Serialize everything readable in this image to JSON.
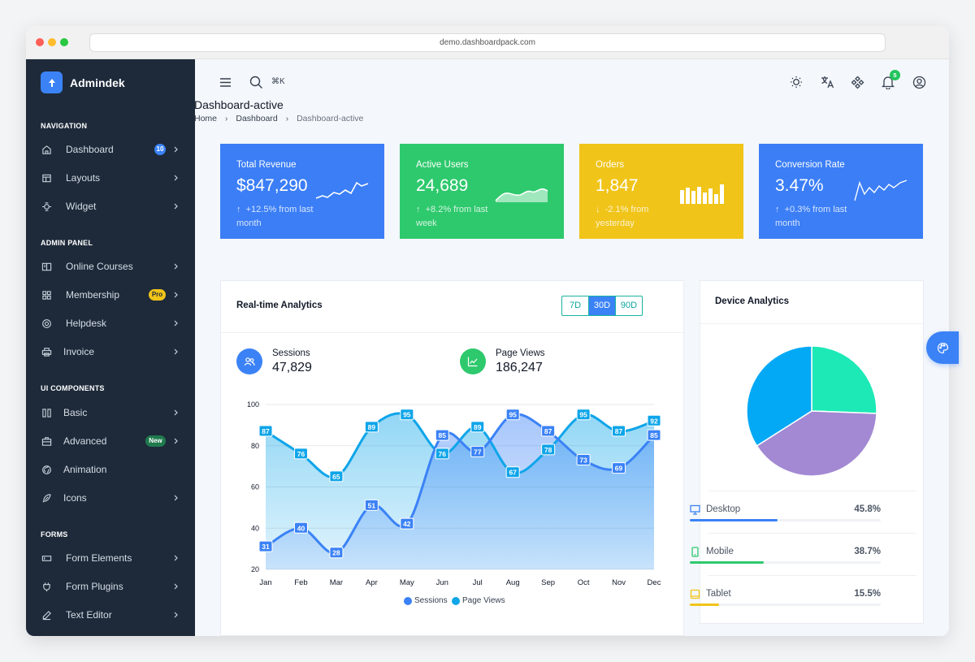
{
  "browser": {
    "url": "demo.dashboardpack.com"
  },
  "app": {
    "name": "Admindek"
  },
  "sidebar": {
    "sections": [
      {
        "title": "NAVIGATION",
        "items": [
          {
            "label": "Dashboard",
            "icon": "home-icon",
            "badge": "10"
          },
          {
            "label": "Layouts",
            "icon": "layout-icon"
          },
          {
            "label": "Widget",
            "icon": "widget-icon"
          }
        ]
      },
      {
        "title": "ADMIN PANEL",
        "items": [
          {
            "label": "Online Courses",
            "icon": "book-icon"
          },
          {
            "label": "Membership",
            "icon": "users-icon",
            "badge": "Pro"
          },
          {
            "label": "Helpdesk",
            "icon": "lifebuoy-icon"
          },
          {
            "label": "Invoice",
            "icon": "printer-icon"
          }
        ]
      },
      {
        "title": "UI COMPONENTS",
        "items": [
          {
            "label": "Basic",
            "icon": "columns-icon"
          },
          {
            "label": "Advanced",
            "icon": "briefcase-icon",
            "badge": "New"
          },
          {
            "label": "Animation",
            "icon": "aperture-icon"
          },
          {
            "label": "Icons",
            "icon": "feather-icon"
          }
        ]
      },
      {
        "title": "FORMS",
        "items": [
          {
            "label": "Form Elements",
            "icon": "input-icon"
          },
          {
            "label": "Form Plugins",
            "icon": "plug-icon"
          },
          {
            "label": "Text Editor",
            "icon": "pen-icon"
          }
        ]
      }
    ]
  },
  "topbar": {
    "search_shortcut": "⌘K",
    "notifications_count": "5"
  },
  "page": {
    "title": "Dashboard-active",
    "breadcrumbs": [
      "Home",
      "Dashboard",
      "Dashboard-active"
    ]
  },
  "stats": [
    {
      "label": "Total Revenue",
      "value": "$847,290",
      "change": "+12.5% from last month",
      "color": "#3b7ef6"
    },
    {
      "label": "Active Users",
      "value": "24,689",
      "change": "+8.2% from last week",
      "color": "#2ec96d"
    },
    {
      "label": "Orders",
      "value": "1,847",
      "change": "-2.1% from yesterday",
      "color": "#f0c419"
    },
    {
      "label": "Conversion Rate",
      "value": "3.47%",
      "change": "+0.3% from last month",
      "color": "#3b7ef6"
    }
  ],
  "analytics": {
    "title": "Real-time Analytics",
    "ranges": [
      "7D",
      "30D",
      "90D"
    ],
    "active_range": "30D",
    "sessions": {
      "label": "Sessions",
      "value": "47,829"
    },
    "pageviews": {
      "label": "Page Views",
      "value": "186,247"
    }
  },
  "chart_data": {
    "type": "area",
    "categories": [
      "Jan",
      "Feb",
      "Mar",
      "Apr",
      "May",
      "Jun",
      "Jul",
      "Aug",
      "Sep",
      "Oct",
      "Nov",
      "Dec"
    ],
    "series": [
      {
        "name": "Sessions",
        "values": [
          31,
          40,
          28,
          51,
          42,
          85,
          77,
          95,
          87,
          73,
          69,
          85
        ],
        "color": "#3b82f6"
      },
      {
        "name": "Page Views",
        "values": [
          87,
          76,
          65,
          89,
          95,
          76,
          89,
          67,
          78,
          95,
          87,
          92
        ],
        "color": "#0ea5e9"
      }
    ],
    "ylim": [
      20,
      100
    ],
    "yticks": [
      20,
      40,
      60,
      80,
      100
    ],
    "legend": "bottom-center",
    "grid": true
  },
  "device": {
    "title": "Device Analytics",
    "items": [
      {
        "label": "Desktop",
        "percent": "45.8%",
        "value": 45.8,
        "color": "#3b82f6"
      },
      {
        "label": "Mobile",
        "percent": "38.7%",
        "value": 38.7,
        "color": "#2ec96d"
      },
      {
        "label": "Tablet",
        "percent": "15.5%",
        "value": 15.5,
        "color": "#f0c419"
      }
    ],
    "pie_colors": [
      "#1de9b6",
      "#a389d4",
      "#04a9f5"
    ]
  }
}
